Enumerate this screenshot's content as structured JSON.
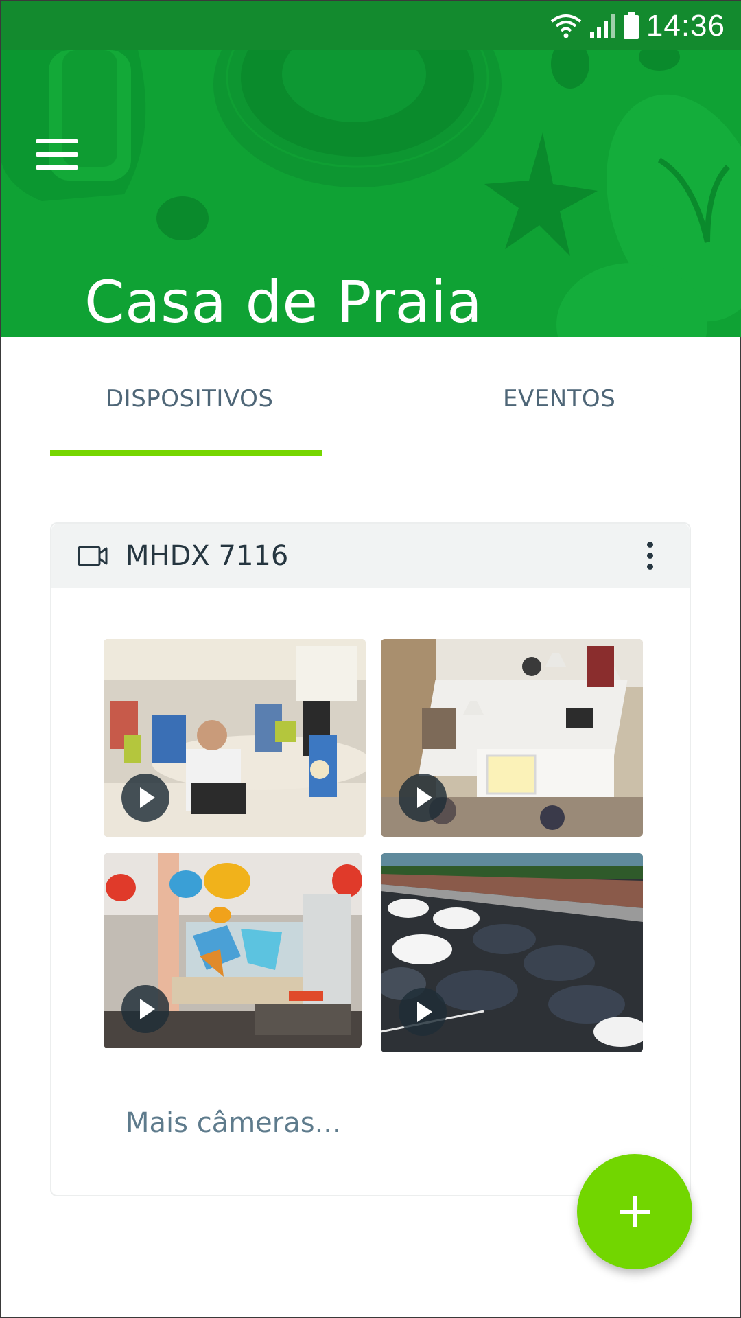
{
  "status_bar": {
    "time": "14:36"
  },
  "header": {
    "title": "Casa de Praia"
  },
  "tabs": [
    {
      "label": "DISPOSITIVOS",
      "active": true
    },
    {
      "label": "EVENTOS",
      "active": false
    }
  ],
  "device": {
    "name": "MHDX 7116",
    "more_cameras": "Mais câmeras...",
    "cameras": [
      {
        "scene": "office-meeting"
      },
      {
        "scene": "open-office"
      },
      {
        "scene": "colorful-lobby"
      },
      {
        "scene": "parking-lot"
      }
    ]
  },
  "colors": {
    "status_bar": "#138a2e",
    "header": "#0fa234",
    "accent": "#76d600",
    "tab_text": "#4e6677"
  }
}
